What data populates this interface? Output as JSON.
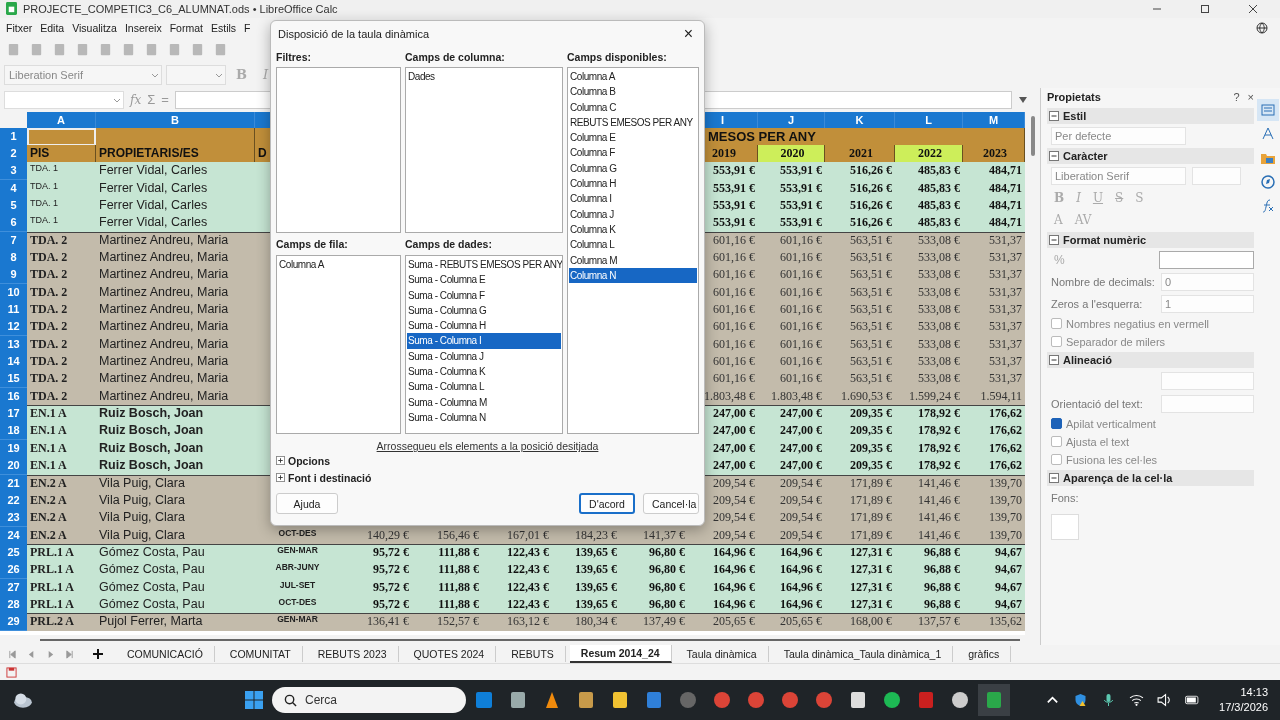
{
  "window": {
    "title": "PROJECTE_COMPETIC3_C6_ALUMNAT.ods • LibreOffice Calc"
  },
  "menu": [
    "Fitxer",
    "Edita",
    "Visualitza",
    "Insereix",
    "Format",
    "Estils",
    "F"
  ],
  "format_toolbar": {
    "font": "Liberation Serif",
    "bold": "B",
    "italic": "I"
  },
  "formula_bar": {
    "function": "fx",
    "sum": "Σ",
    "equals": "="
  },
  "columns_left": [
    "A",
    "B"
  ],
  "columns_right": [
    "I",
    "J",
    "K",
    "L",
    "M"
  ],
  "title_row": {
    "n": "1",
    "text": "MESOS PER ANY"
  },
  "header_row": {
    "n": "2",
    "pis": "PIS",
    "owner": "PROPIETARIS/ES",
    "col_c": "D",
    "years": [
      {
        "label": "2019",
        "highlight": false
      },
      {
        "label": "2020",
        "highlight": true
      },
      {
        "label": "2021",
        "highlight": false
      },
      {
        "label": "2022",
        "highlight": true
      },
      {
        "label": "2023",
        "highlight": false
      }
    ]
  },
  "rows": [
    {
      "n": "3",
      "pis": "TDA. 1",
      "owner": "Ferrer Vidal, Carles",
      "values": [
        "553,91 €",
        "553,91 €",
        "516,26 €",
        "485,83 €",
        "484,71"
      ],
      "color": "#c6e5d3",
      "bold": true,
      "owner_bold": false,
      "pis_small": true
    },
    {
      "n": "4",
      "pis": "TDA. 1",
      "owner": "Ferrer Vidal, Carles",
      "values": [
        "553,91 €",
        "553,91 €",
        "516,26 €",
        "485,83 €",
        "484,71"
      ],
      "color": "#c6e5d3",
      "bold": true,
      "owner_bold": false,
      "pis_small": true
    },
    {
      "n": "5",
      "pis": "TDA. 1",
      "owner": "Ferrer Vidal, Carles",
      "values": [
        "553,91 €",
        "553,91 €",
        "516,26 €",
        "485,83 €",
        "484,71"
      ],
      "color": "#c6e5d3",
      "bold": true,
      "owner_bold": false,
      "pis_small": true
    },
    {
      "n": "6",
      "pis": "TDA. 1",
      "owner": "Ferrer Vidal, Carles",
      "values": [
        "553,91 €",
        "553,91 €",
        "516,26 €",
        "485,83 €",
        "484,71"
      ],
      "color": "#c6e5d3",
      "bold": true,
      "owner_bold": false,
      "pis_small": true
    },
    {
      "n": "7",
      "pis": "TDA. 2",
      "owner": "Martinez Andreu, Maria",
      "values": [
        "601,16 €",
        "601,16 €",
        "563,51 €",
        "533,08 €",
        "531,37"
      ],
      "color": "#c3bbab",
      "bold": false,
      "owner_bold": false,
      "pis_small": false
    },
    {
      "n": "8",
      "pis": "TDA. 2",
      "owner": "Martinez Andreu, Maria",
      "values": [
        "601,16 €",
        "601,16 €",
        "563,51 €",
        "533,08 €",
        "531,37"
      ],
      "color": "#c3bbab",
      "bold": false,
      "owner_bold": false,
      "pis_small": false
    },
    {
      "n": "9",
      "pis": "TDA. 2",
      "owner": "Martinez Andreu, Maria",
      "values": [
        "601,16 €",
        "601,16 €",
        "563,51 €",
        "533,08 €",
        "531,37"
      ],
      "color": "#c3bbab",
      "bold": false,
      "owner_bold": false,
      "pis_small": false
    },
    {
      "n": "10",
      "pis": "TDA. 2",
      "owner": "Martinez Andreu, Maria",
      "values": [
        "601,16 €",
        "601,16 €",
        "563,51 €",
        "533,08 €",
        "531,37"
      ],
      "color": "#c3bbab",
      "bold": false,
      "owner_bold": false,
      "pis_small": false
    },
    {
      "n": "11",
      "pis": "TDA. 2",
      "owner": "Martinez Andreu, Maria",
      "values": [
        "601,16 €",
        "601,16 €",
        "563,51 €",
        "533,08 €",
        "531,37"
      ],
      "color": "#c3bbab",
      "bold": false,
      "owner_bold": false,
      "pis_small": false
    },
    {
      "n": "12",
      "pis": "TDA. 2",
      "owner": "Martinez Andreu, Maria",
      "values": [
        "601,16 €",
        "601,16 €",
        "563,51 €",
        "533,08 €",
        "531,37"
      ],
      "color": "#c3bbab",
      "bold": false,
      "owner_bold": false,
      "pis_small": false
    },
    {
      "n": "13",
      "pis": "TDA. 2",
      "owner": "Martinez Andreu, Maria",
      "values": [
        "601,16 €",
        "601,16 €",
        "563,51 €",
        "533,08 €",
        "531,37"
      ],
      "color": "#c3bbab",
      "bold": false,
      "owner_bold": false,
      "pis_small": false
    },
    {
      "n": "14",
      "pis": "TDA. 2",
      "owner": "Martinez Andreu, Maria",
      "values": [
        "601,16 €",
        "601,16 €",
        "563,51 €",
        "533,08 €",
        "531,37"
      ],
      "color": "#c3bbab",
      "bold": false,
      "owner_bold": false,
      "pis_small": false
    },
    {
      "n": "15",
      "pis": "TDA. 2",
      "owner": "Martinez Andreu, Maria",
      "values": [
        "601,16 €",
        "601,16 €",
        "563,51 €",
        "533,08 €",
        "531,37"
      ],
      "color": "#c3bbab",
      "bold": false,
      "owner_bold": false,
      "pis_small": false
    },
    {
      "n": "16",
      "pis": "TDA. 2",
      "owner": "Martinez Andreu, Maria",
      "values": [
        "1.803,48 €",
        "1.803,48 €",
        "1.690,53 €",
        "1.599,24 €",
        "1.594,11"
      ],
      "color": "#c3bbab",
      "bold": false,
      "owner_bold": false,
      "pis_small": false
    },
    {
      "n": "17",
      "pis": "EN.1 A",
      "owner": "Ruiz Bosch, Joan",
      "values": [
        "247,00 €",
        "247,00 €",
        "209,35 €",
        "178,92 €",
        "176,62"
      ],
      "color": "#c6e5d3",
      "bold": true,
      "owner_bold": true,
      "pis_small": false
    },
    {
      "n": "18",
      "pis": "EN.1 A",
      "owner": "Ruiz Bosch, Joan",
      "values": [
        "247,00 €",
        "247,00 €",
        "209,35 €",
        "178,92 €",
        "176,62"
      ],
      "color": "#c6e5d3",
      "bold": true,
      "owner_bold": true,
      "pis_small": false
    },
    {
      "n": "19",
      "pis": "EN.1 A",
      "owner": "Ruiz Bosch, Joan",
      "values": [
        "247,00 €",
        "247,00 €",
        "209,35 €",
        "178,92 €",
        "176,62"
      ],
      "color": "#c6e5d3",
      "bold": true,
      "owner_bold": true,
      "pis_small": false
    },
    {
      "n": "20",
      "pis": "EN.1 A",
      "owner": "Ruiz Bosch, Joan",
      "values": [
        "247,00 €",
        "247,00 €",
        "209,35 €",
        "178,92 €",
        "176,62"
      ],
      "color": "#c6e5d3",
      "bold": true,
      "owner_bold": true,
      "pis_small": false
    },
    {
      "n": "21",
      "pis": "EN.2 A",
      "owner": "Vila Puig, Clara",
      "values": [
        "209,54 €",
        "209,54 €",
        "171,89 €",
        "141,46 €",
        "139,70"
      ],
      "color": "#c3bbab",
      "bold": false,
      "owner_bold": false,
      "pis_small": false
    },
    {
      "n": "22",
      "pis": "EN.2 A",
      "owner": "Vila Puig, Clara",
      "values": [
        "209,54 €",
        "209,54 €",
        "171,89 €",
        "141,46 €",
        "139,70"
      ],
      "color": "#c3bbab",
      "bold": false,
      "owner_bold": false,
      "pis_small": false
    },
    {
      "n": "23",
      "pis": "EN.2 A",
      "owner": "Vila Puig, Clara",
      "values": [
        "209,54 €",
        "209,54 €",
        "171,89 €",
        "141,46 €",
        "139,70"
      ],
      "color": "#c3bbab",
      "bold": false,
      "owner_bold": false,
      "pis_small": false
    },
    {
      "n": "24",
      "pis": "EN.2 A",
      "owner": "Vila Puig, Clara",
      "period": "OCT-DES",
      "values": [
        "140,29 €",
        "156,46 €",
        "167,01 €",
        "184,23 €",
        "141,37 €",
        "209,54 €",
        "209,54 €",
        "171,89 €",
        "141,46 €",
        "139,70"
      ],
      "color": "#c3bbab",
      "bold": false,
      "owner_bold": false,
      "pis_small": false
    },
    {
      "n": "25",
      "pis": "PRL.1 A",
      "owner": "Gómez Costa, Pau",
      "period": "GEN-MAR",
      "values": [
        "95,72 €",
        "111,88 €",
        "122,43 €",
        "139,65 €",
        "96,80 €",
        "164,96 €",
        "164,96 €",
        "127,31 €",
        "96,88 €",
        "94,67"
      ],
      "color": "#c6e5d3",
      "bold": true,
      "owner_bold": false,
      "pis_small": false
    },
    {
      "n": "26",
      "pis": "PRL.1 A",
      "owner": "Gómez Costa, Pau",
      "period": "ABR-JUNY",
      "values": [
        "95,72 €",
        "111,88 €",
        "122,43 €",
        "139,65 €",
        "96,80 €",
        "164,96 €",
        "164,96 €",
        "127,31 €",
        "96,88 €",
        "94,67"
      ],
      "color": "#c6e5d3",
      "bold": true,
      "owner_bold": false,
      "pis_small": false
    },
    {
      "n": "27",
      "pis": "PRL.1 A",
      "owner": "Gómez Costa, Pau",
      "period": "JUL-SET",
      "values": [
        "95,72 €",
        "111,88 €",
        "122,43 €",
        "139,65 €",
        "96,80 €",
        "164,96 €",
        "164,96 €",
        "127,31 €",
        "96,88 €",
        "94,67"
      ],
      "color": "#c6e5d3",
      "bold": true,
      "owner_bold": false,
      "pis_small": false
    },
    {
      "n": "28",
      "pis": "PRL.1 A",
      "owner": "Gómez Costa, Pau",
      "period": "OCT-DES",
      "values": [
        "95,72 €",
        "111,88 €",
        "122,43 €",
        "139,65 €",
        "96,80 €",
        "164,96 €",
        "164,96 €",
        "127,31 €",
        "96,88 €",
        "94,67"
      ],
      "color": "#c6e5d3",
      "bold": true,
      "owner_bold": false,
      "pis_small": false
    },
    {
      "n": "29",
      "pis": "PRL.2 A",
      "owner": "Pujol Ferrer, Marta",
      "period": "GEN-MAR",
      "values": [
        "136,41 €",
        "152,57 €",
        "163,12 €",
        "180,34 €",
        "137,49 €",
        "205,65 €",
        "205,65 €",
        "168,00 €",
        "137,57 €",
        "135,62"
      ],
      "color": "#c3bbab",
      "bold": false,
      "owner_bold": false,
      "pis_small": false
    }
  ],
  "dialog": {
    "title": "Disposició de la taula dinàmica",
    "close": "×",
    "filters": {
      "label": "Filtres:"
    },
    "column_fields": {
      "label": "Camps de columna:",
      "items": [
        {
          "label": "Dades",
          "selected": false
        }
      ]
    },
    "available_fields": {
      "label": "Camps disponibles:",
      "items": [
        {
          "label": "Columna A",
          "selected": false
        },
        {
          "label": "Columna B",
          "selected": false
        },
        {
          "label": "Columna C",
          "selected": false
        },
        {
          "label": "REBUTS EMESOS PER ANY",
          "selected": false
        },
        {
          "label": "Columna E",
          "selected": false
        },
        {
          "label": "Columna F",
          "selected": false
        },
        {
          "label": "Columna G",
          "selected": false
        },
        {
          "label": "Columna H",
          "selected": false
        },
        {
          "label": "Columna I",
          "selected": false
        },
        {
          "label": "Columna J",
          "selected": false
        },
        {
          "label": "Columna K",
          "selected": false
        },
        {
          "label": "Columna L",
          "selected": false
        },
        {
          "label": "Columna M",
          "selected": false
        },
        {
          "label": "Columna N",
          "selected": true
        }
      ]
    },
    "row_fields": {
      "label": "Camps de fila:",
      "items": [
        {
          "label": "Columna A",
          "selected": false
        }
      ]
    },
    "data_fields": {
      "label": "Camps de dades:",
      "items": [
        {
          "label": "Suma - REBUTS EMESOS PER ANY",
          "selected": false
        },
        {
          "label": "Suma - Columna E",
          "selected": false
        },
        {
          "label": "Suma - Columna F",
          "selected": false
        },
        {
          "label": "Suma - Columna G",
          "selected": false
        },
        {
          "label": "Suma - Columna H",
          "selected": false
        },
        {
          "label": "Suma - Columna I",
          "selected": true
        },
        {
          "label": "Suma - Columna J",
          "selected": false
        },
        {
          "label": "Suma - Columna K",
          "selected": false
        },
        {
          "label": "Suma - Columna L",
          "selected": false
        },
        {
          "label": "Suma - Columna M",
          "selected": false
        },
        {
          "label": "Suma - Columna N",
          "selected": false
        }
      ]
    },
    "hint": "Arrossegueu els elements a la posició desitjada",
    "expanders": [
      {
        "label": "Opcions",
        "expanded": false
      },
      {
        "label": "Font i destinació",
        "expanded": false
      }
    ],
    "buttons": [
      {
        "label": "Ajuda",
        "kind": "help"
      },
      {
        "label": "D'acord",
        "kind": "default"
      },
      {
        "label": "Cancel·la",
        "kind": "cancel"
      }
    ]
  },
  "sidebar": {
    "title": "Propietats",
    "help": "?",
    "close": "×",
    "style": {
      "heading": "Estil",
      "value": "Per defecte"
    },
    "character": {
      "heading": "Caràcter",
      "font": "Liberation Serif",
      "format_buttons": [
        "B",
        "I",
        "U",
        "S",
        "S"
      ],
      "extra_buttons": [
        "A",
        "AV"
      ]
    },
    "number_format": {
      "heading": "Format numèric",
      "percent": "%",
      "decimals_label": "Nombre de decimals:",
      "decimals": "0",
      "zeros_label": "Zeros a l'esquerra:",
      "zeros": "1",
      "options": [
        {
          "label": "Nombres negatius en vermell",
          "checked": false
        },
        {
          "label": "Separador de milers",
          "checked": false
        }
      ]
    },
    "alignment": {
      "heading": "Alineació",
      "orientation_label": "Orientació del text:",
      "options": [
        {
          "label": "Apilat verticalment",
          "checked": true
        },
        {
          "label": "Ajusta el text",
          "checked": false
        },
        {
          "label": "Fusiona les cel·les",
          "checked": false
        }
      ]
    },
    "appearance": {
      "heading": "Aparença de la cel·la",
      "background_label": "Fons:"
    }
  },
  "sheet_tabs": [
    {
      "label": "COMUNICACIÓ",
      "selected": false
    },
    {
      "label": "COMUNITAT",
      "selected": false
    },
    {
      "label": "REBUTS 2023",
      "selected": false
    },
    {
      "label": "QUOTES 2024",
      "selected": false
    },
    {
      "label": "REBUTS",
      "selected": false
    },
    {
      "label": "Resum 2014_24",
      "selected": true
    },
    {
      "label": "Taula dinàmica",
      "selected": false
    },
    {
      "label": "Taula dinàmica_Taula dinàmica_1",
      "selected": false
    },
    {
      "label": "gràfics",
      "selected": false
    }
  ],
  "taskbar": {
    "search": "Cerca",
    "time": "14:13",
    "date": "17/3/2026"
  }
}
